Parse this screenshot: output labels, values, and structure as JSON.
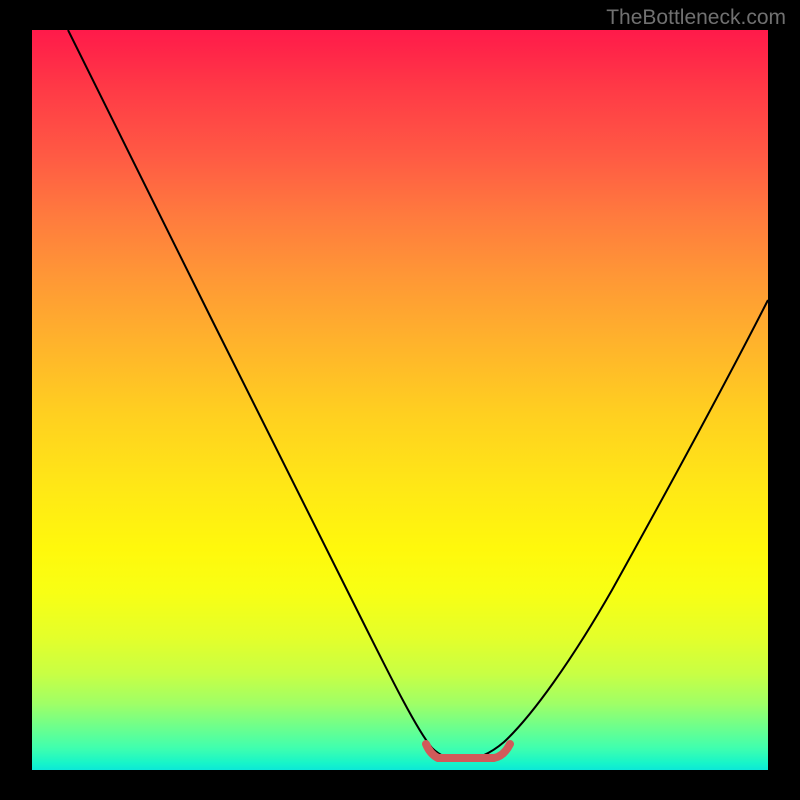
{
  "watermark": "TheBottleneck.com",
  "chart_data": {
    "type": "line",
    "title": "",
    "xlabel": "",
    "ylabel": "",
    "xlim": [
      0,
      100
    ],
    "ylim": [
      0,
      100
    ],
    "series": [
      {
        "name": "bottleneck-curve",
        "x": [
          5,
          10,
          15,
          20,
          25,
          30,
          35,
          40,
          45,
          50,
          53,
          55,
          58,
          60,
          65,
          70,
          75,
          80,
          85,
          90,
          95,
          100
        ],
        "y": [
          100,
          90,
          80,
          70,
          60,
          50,
          40,
          30,
          20,
          10,
          4,
          1,
          0,
          0,
          2,
          8,
          16,
          25,
          35,
          45,
          55,
          65
        ]
      }
    ],
    "highlight": {
      "name": "optimal-range",
      "x_range": [
        54,
        65
      ],
      "y": 1,
      "color": "#d15a5a"
    },
    "gradient_stops": [
      {
        "pos": 0,
        "color": "#ff1a4a"
      },
      {
        "pos": 50,
        "color": "#ffd020"
      },
      {
        "pos": 80,
        "color": "#e4ff2a"
      },
      {
        "pos": 100,
        "color": "#0ce8d8"
      }
    ]
  }
}
